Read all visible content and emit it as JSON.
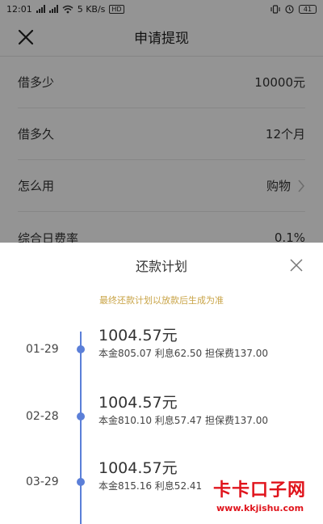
{
  "status_bar": {
    "time": "12:01",
    "network_speed": "5 KB/s",
    "hd_badge": "HD",
    "battery": "41"
  },
  "header": {
    "title": "申请提现"
  },
  "form": {
    "rows": [
      {
        "label": "借多少",
        "value": "10000元"
      },
      {
        "label": "借多久",
        "value": "12个月"
      },
      {
        "label": "怎么用",
        "value": "购物"
      },
      {
        "label": "综合日费率",
        "value": "0.1%"
      }
    ]
  },
  "repayment_plan": {
    "title": "还款计划",
    "note": "最终还款计划以放款后生成为准",
    "items": [
      {
        "date": "01-29",
        "amount": "1004.57元",
        "detail": "本金805.07 利息62.50 担保费137.00"
      },
      {
        "date": "02-28",
        "amount": "1004.57元",
        "detail": "本金810.10 利息57.47 担保费137.00"
      },
      {
        "date": "03-29",
        "amount": "1004.57元",
        "detail": "本金815.16 利息52.41"
      }
    ]
  },
  "watermark": {
    "title": "卡卡口子网",
    "url": "www.kkjishu.com"
  },
  "colors": {
    "timeline": "#5b7fd8",
    "note": "#c9a447",
    "watermark": "#e0141c"
  }
}
